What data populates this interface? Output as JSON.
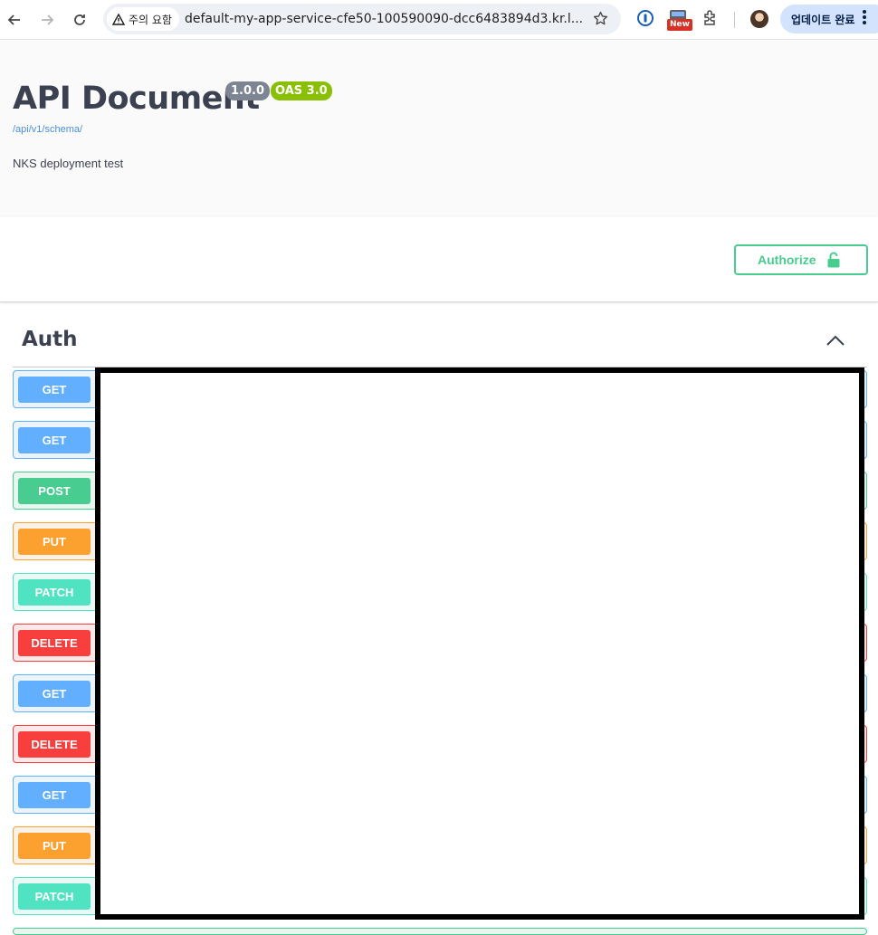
{
  "browser": {
    "security_chip": "주의 요함",
    "url": "default-my-app-service-cfe50-100590090-dcc6483894d3.kr.l...",
    "new_badge": "New",
    "update_button": "업데이트 완료"
  },
  "info": {
    "title": "API Document",
    "version": "1.0.0",
    "oas": "OAS 3.0",
    "schema_link": "/api/v1/schema/",
    "description": "NKS deployment test"
  },
  "scheme": {
    "authorize_label": "Authorize"
  },
  "tag": {
    "title": "Auth",
    "operations": [
      {
        "method": "GET",
        "type": "get"
      },
      {
        "method": "GET",
        "type": "get"
      },
      {
        "method": "POST",
        "type": "post"
      },
      {
        "method": "PUT",
        "type": "put"
      },
      {
        "method": "PATCH",
        "type": "patch"
      },
      {
        "method": "DELETE",
        "type": "delete"
      },
      {
        "method": "GET",
        "type": "get"
      },
      {
        "method": "DELETE",
        "type": "delete"
      },
      {
        "method": "GET",
        "type": "get"
      },
      {
        "method": "PUT",
        "type": "put"
      },
      {
        "method": "PATCH",
        "type": "patch"
      }
    ]
  },
  "colors": {
    "get": "#61affe",
    "post": "#49cc90",
    "put": "#fca130",
    "patch": "#50e3c2",
    "delete": "#f93e3e",
    "title_text": "#3b4151"
  }
}
